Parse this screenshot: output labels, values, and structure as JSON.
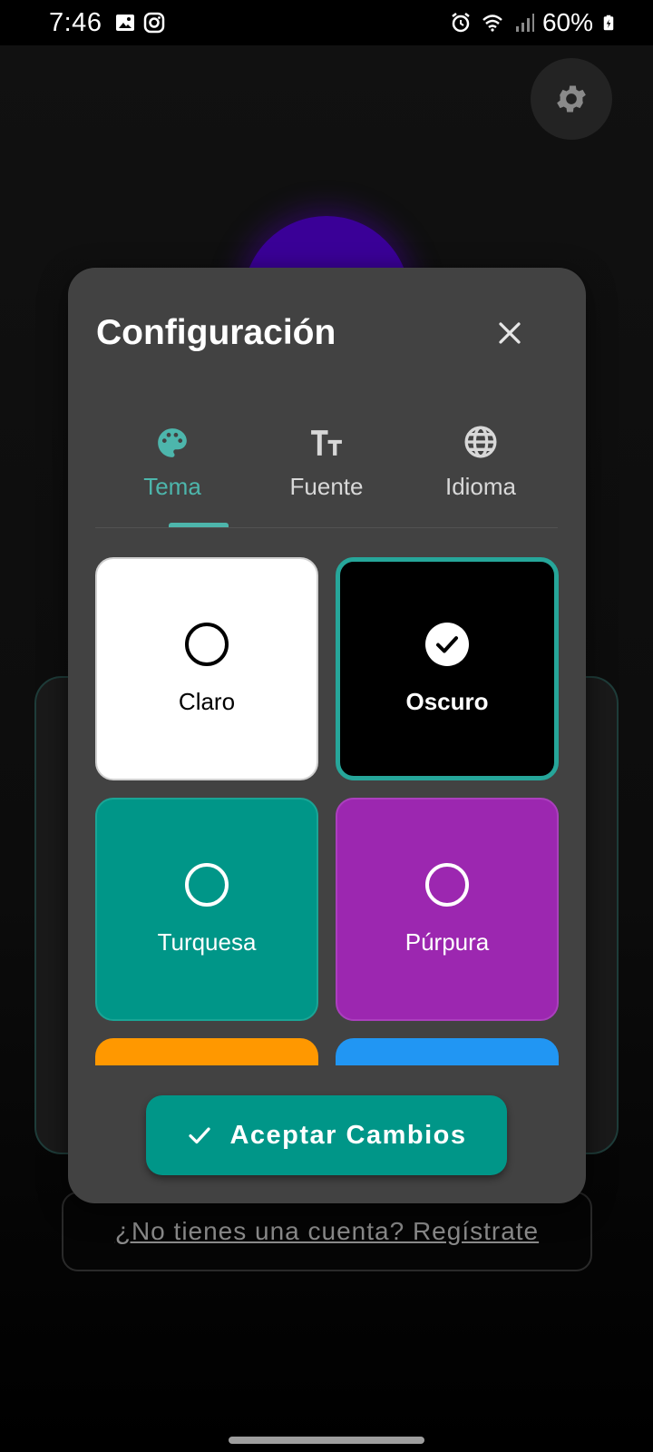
{
  "status_bar": {
    "time": "7:46",
    "battery": "60%",
    "left_icons": [
      "gallery-icon",
      "instagram-icon"
    ],
    "right_icons": [
      "alarm-icon",
      "wifi-icon",
      "signal-icon",
      "battery-icon"
    ]
  },
  "background": {
    "register_link": "¿No tienes una cuenta? Regístrate"
  },
  "dialog": {
    "title": "Configuración",
    "tabs": [
      {
        "label": "Tema",
        "icon": "palette-icon",
        "active": true
      },
      {
        "label": "Fuente",
        "icon": "text-size-icon",
        "active": false
      },
      {
        "label": "Idioma",
        "icon": "globe-icon",
        "active": false
      }
    ],
    "themes": [
      {
        "label": "Claro",
        "color": "#ffffff",
        "selected": false
      },
      {
        "label": "Oscuro",
        "color": "#000000",
        "selected": true
      },
      {
        "label": "Turquesa",
        "color": "#009688",
        "selected": false
      },
      {
        "label": "Púrpura",
        "color": "#9c27b0",
        "selected": false
      },
      {
        "label": "",
        "color": "#ff9800",
        "selected": false
      },
      {
        "label": "",
        "color": "#2196f3",
        "selected": false
      }
    ],
    "accept_label": "Aceptar Cambios"
  },
  "colors": {
    "accent": "#009688",
    "tab_active": "#4db6ac",
    "dialog_bg": "#424242"
  }
}
